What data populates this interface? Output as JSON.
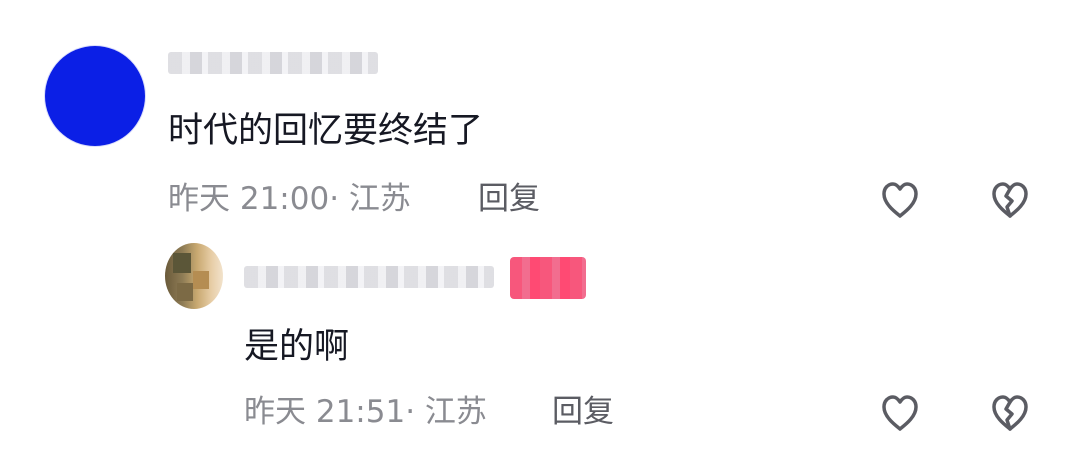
{
  "comments": [
    {
      "content": "时代的回忆要终结了",
      "meta": "昨天 21:00· 江苏",
      "reply_label": "回复"
    }
  ],
  "replies": [
    {
      "content": "是的啊",
      "meta": "昨天 21:51· 江苏",
      "reply_label": "回复"
    }
  ],
  "colors": {
    "main_avatar": "#0b1fe6",
    "badge": "#f7577c",
    "meta_text": "#8a8b91",
    "body_text": "#161823",
    "icon_stroke": "#5b5c63"
  },
  "icons": {
    "like": "heart-icon",
    "dislike": "broken-heart-icon"
  }
}
